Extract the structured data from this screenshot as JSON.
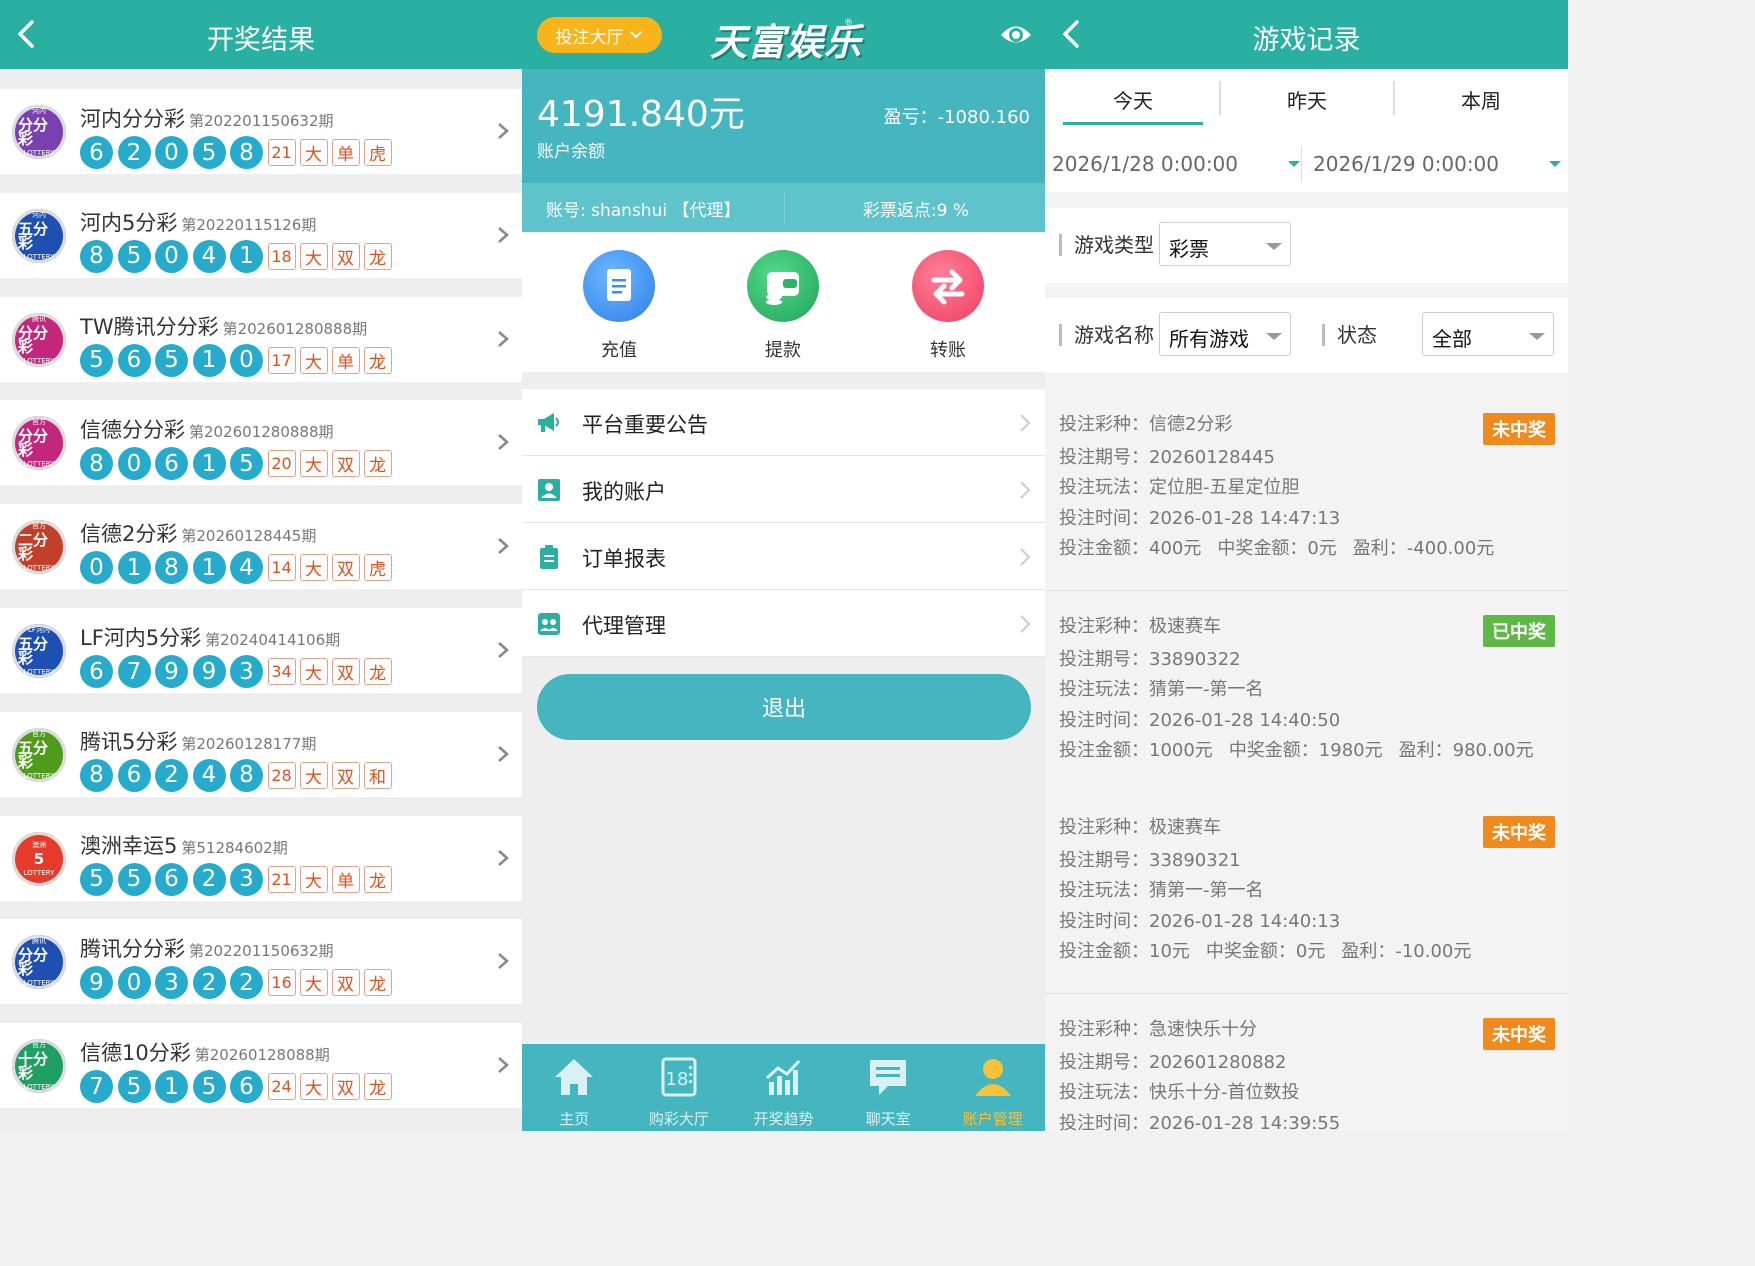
{
  "results": {
    "title": "开奖结果",
    "items": [
      {
        "name": "河内分分彩",
        "period": "第202201150632期",
        "logo": "分分彩",
        "logo_top": "河内",
        "color": "#7a3fb0",
        "balls": [
          "6",
          "2",
          "0",
          "5",
          "8"
        ],
        "sum": "21",
        "size": "大",
        "parity": "单",
        "dt": "虎"
      },
      {
        "name": "河内5分彩",
        "period": "第20220115126期",
        "logo": "五分彩",
        "logo_top": "河内",
        "color": "#1e4fb3",
        "balls": [
          "8",
          "5",
          "0",
          "4",
          "1"
        ],
        "sum": "18",
        "size": "大",
        "parity": "双",
        "dt": "龙"
      },
      {
        "name": "TW腾讯分分彩",
        "period": "第202601280888期",
        "logo": "分分彩",
        "logo_top": "腾讯",
        "color": "#c2277d",
        "balls": [
          "5",
          "6",
          "5",
          "1",
          "0"
        ],
        "sum": "17",
        "size": "大",
        "parity": "单",
        "dt": "龙"
      },
      {
        "name": "信德分分彩",
        "period": "第202601280888期",
        "logo": "分分彩",
        "logo_top": "官方",
        "color": "#c2277d",
        "balls": [
          "8",
          "0",
          "6",
          "1",
          "5"
        ],
        "sum": "20",
        "size": "大",
        "parity": "双",
        "dt": "龙"
      },
      {
        "name": "信德2分彩",
        "period": "第20260128445期",
        "logo": "二分彩",
        "logo_top": "官方",
        "color": "#c2402b",
        "balls": [
          "0",
          "1",
          "8",
          "1",
          "4"
        ],
        "sum": "14",
        "size": "大",
        "parity": "双",
        "dt": "虎"
      },
      {
        "name": "LF河内5分彩",
        "period": "第20240414106期",
        "logo": "五分彩",
        "logo_top": "LF河内",
        "color": "#1e4fb3",
        "balls": [
          "6",
          "7",
          "9",
          "9",
          "3"
        ],
        "sum": "34",
        "size": "大",
        "parity": "双",
        "dt": "龙"
      },
      {
        "name": "腾讯5分彩",
        "period": "第20260128177期",
        "logo": "五分彩",
        "logo_top": "官方",
        "color": "#4f9c1d",
        "balls": [
          "8",
          "6",
          "2",
          "4",
          "8"
        ],
        "sum": "28",
        "size": "大",
        "parity": "双",
        "dt": "和"
      },
      {
        "name": "澳洲幸运5",
        "period": "第51284602期",
        "logo": "5",
        "logo_top": "澳洲",
        "color": "#e63a2a",
        "balls": [
          "5",
          "5",
          "6",
          "2",
          "3"
        ],
        "sum": "21",
        "size": "大",
        "parity": "单",
        "dt": "龙"
      },
      {
        "name": "腾讯分分彩",
        "period": "第202201150632期",
        "logo": "分分彩",
        "logo_top": "腾讯",
        "color": "#1e4fb3",
        "balls": [
          "9",
          "0",
          "3",
          "2",
          "2"
        ],
        "sum": "16",
        "size": "大",
        "parity": "双",
        "dt": "龙"
      },
      {
        "name": "信德10分彩",
        "period": "第20260128088期",
        "logo": "十分彩",
        "logo_top": "官方",
        "color": "#1f9f62",
        "balls": [
          "7",
          "5",
          "1",
          "5",
          "6"
        ],
        "sum": "24",
        "size": "大",
        "parity": "双",
        "dt": "龙"
      }
    ]
  },
  "account": {
    "hall_button": "投注大厅",
    "brand": "天富娱乐",
    "balance": "4191.840元",
    "balance_label": "账户余额",
    "profit": "盈亏：-1080.160",
    "account_line": "账号:   shanshui 【代理】",
    "rebate": "彩票返点:9 %",
    "actions": [
      "充值",
      "提款",
      "转账"
    ],
    "menu": [
      "平台重要公告",
      "我的账户",
      "订单报表",
      "代理管理"
    ],
    "logout": "退出",
    "tabs": [
      "主页",
      "购彩大厅",
      "开奖趋势",
      "聊天室",
      "账户管理"
    ]
  },
  "records": {
    "title": "游戏记录",
    "segments": [
      "今天",
      "昨天",
      "本周"
    ],
    "date_from": "2026/1/28 0:00:00",
    "date_to": "2026/1/29 0:00:00",
    "game_type_label": "游戏类型",
    "game_type": "彩票",
    "game_name_label": "游戏名称",
    "game_name": "所有游戏",
    "status_label": "状态",
    "status": "全部",
    "items": [
      {
        "lottery": "投注彩种：信德2分彩",
        "period": "投注期号：20260128445",
        "play": "投注玩法：定位胆-五星定位胆",
        "time": "投注时间：2026-01-28 14:47:13",
        "amount": "投注金额：400元",
        "win": "中奖金额：0元",
        "profit": "盈利：-400.00元",
        "badge": "未中奖",
        "badge_color": "#f08a1c"
      },
      {
        "lottery": "投注彩种：极速赛车",
        "period": "投注期号：33890322",
        "play": "投注玩法：猜第一-第一名",
        "time": "投注时间：2026-01-28 14:40:50",
        "amount": "投注金额：1000元",
        "win": "中奖金额：1980元",
        "profit": "盈利：980.00元",
        "badge": "已中奖",
        "badge_color": "#5db845"
      },
      {
        "lottery": "投注彩种：极速赛车",
        "period": "投注期号：33890321",
        "play": "投注玩法：猜第一-第一名",
        "time": "投注时间：2026-01-28 14:40:13",
        "amount": "投注金额：10元",
        "win": "中奖金额：0元",
        "profit": "盈利：-10.00元",
        "badge": "未中奖",
        "badge_color": "#f08a1c"
      },
      {
        "lottery": "投注彩种：急速快乐十分",
        "period": "投注期号：202601280882",
        "play": "投注玩法：快乐十分-首位数投",
        "time": "投注时间：2026-01-28 14:39:55",
        "amount": "",
        "win": "",
        "profit": "",
        "badge": "未中奖",
        "badge_color": "#f08a1c"
      }
    ]
  }
}
